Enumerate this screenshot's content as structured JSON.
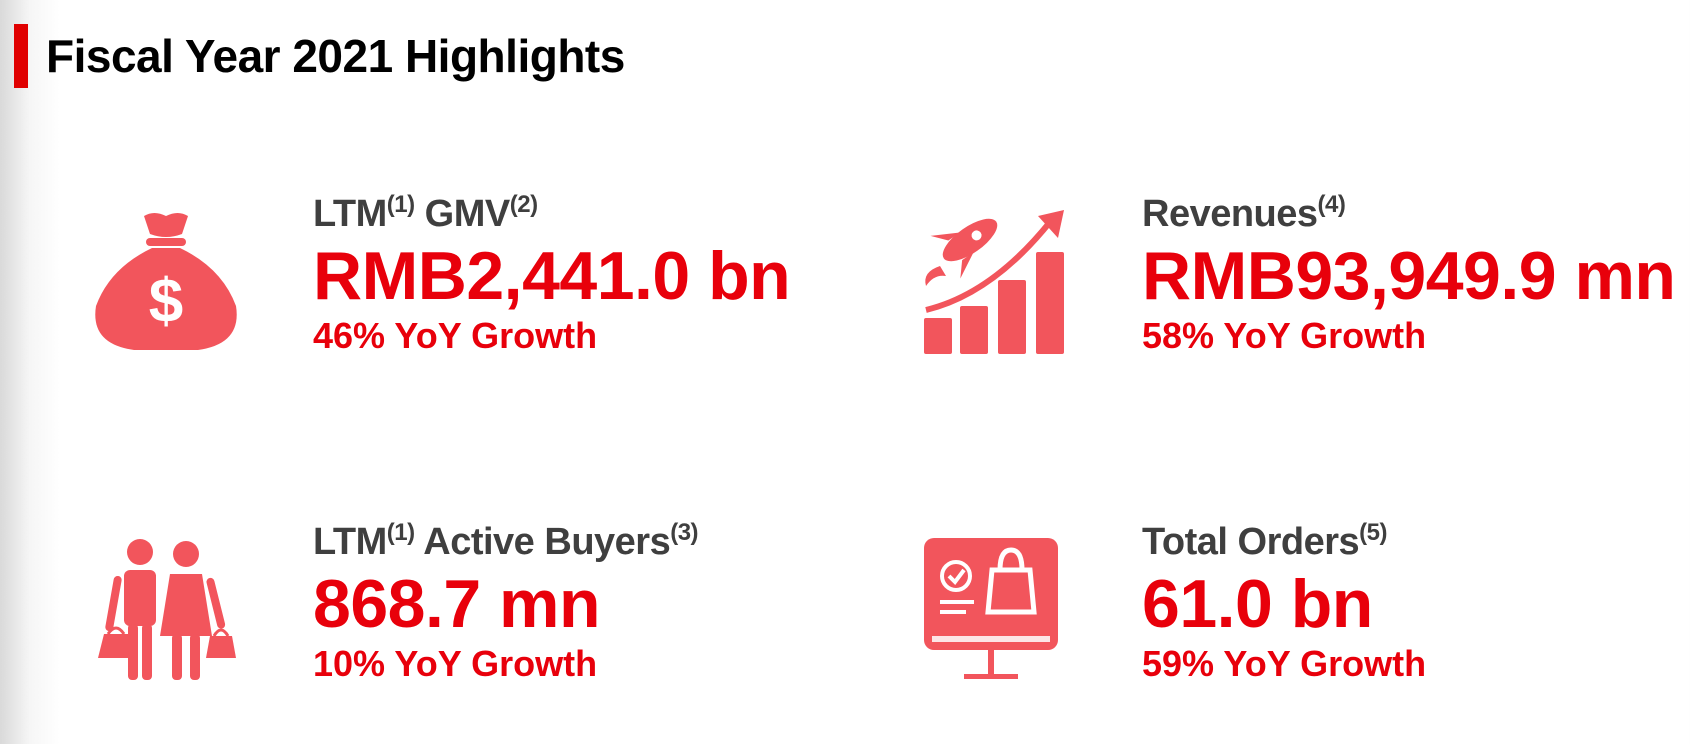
{
  "page_title": "Fiscal Year 2021 Highlights",
  "colors": {
    "accent_red": "#e8000b",
    "icon_red": "#f2555c",
    "label_gray": "#3f3f3f"
  },
  "metrics": [
    {
      "icon": "money-bag-icon",
      "label": "LTM",
      "label_sup1": "(1)",
      "label_suffix": " GMV",
      "label_sup2": "(2)",
      "value": "RMB2,441.0 bn",
      "growth": "46% YoY Growth"
    },
    {
      "icon": "rocket-growth-chart-icon",
      "label": "Revenues",
      "label_sup1": "(4)",
      "value": "RMB93,949.9 mn",
      "growth": "58% YoY Growth"
    },
    {
      "icon": "shoppers-icon",
      "label": "LTM",
      "label_sup1": "(1)",
      "label_suffix": " Active Buyers",
      "label_sup2": "(3)",
      "value": "868.7 mn",
      "growth": "10% YoY Growth"
    },
    {
      "icon": "online-shopping-monitor-icon",
      "label": "Total Orders",
      "label_sup1": "(5)",
      "value": "61.0 bn",
      "growth": "59% YoY Growth"
    }
  ]
}
